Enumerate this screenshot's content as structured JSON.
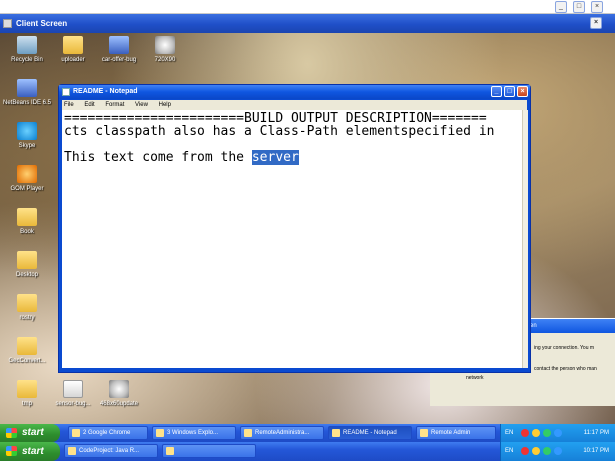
{
  "outer": {
    "title": "Client Screen"
  },
  "desktop_icons": [
    {
      "label": "Recycle Bin"
    },
    {
      "label": "uploader"
    },
    {
      "label": "car-offer-bug"
    },
    {
      "label": "720X90"
    },
    {
      "label": "NetBeans IDE 6.5"
    },
    {
      "label": "Skype"
    },
    {
      "label": "GOM Player"
    },
    {
      "label": "Book"
    },
    {
      "label": "Desktop"
    },
    {
      "label": "rostry"
    },
    {
      "label": "GecConvert..."
    },
    {
      "label": "tmp"
    },
    {
      "label": "sensor-bug..."
    },
    {
      "label": "468x60update"
    }
  ],
  "notepad": {
    "title": "README - Notepad",
    "menu": [
      "File",
      "Edit",
      "Format",
      "View",
      "Help"
    ],
    "lines": [
      "=======================BUILD OUTPUT DESCRIPTION=======",
      "cts classpath also has a Class-Path elementspecified in",
      ""
    ],
    "last_line_prefix": "This text come from the ",
    "selected_text": "server"
  },
  "side_dialog": {
    "bar_text": "en",
    "line1": "ing your connection. You m",
    "line2": "contact the person who man",
    "line3": "network"
  },
  "taskbar_inner": {
    "start_label": "start",
    "buttons": [
      {
        "label": "2 Google Chrome"
      },
      {
        "label": "3 Windows Explo..."
      },
      {
        "label": "RemoteAdministra..."
      },
      {
        "label": "README - Notepad"
      },
      {
        "label": "Remote Admin"
      }
    ],
    "lang": "EN",
    "clock": "11:17 PM"
  },
  "taskbar_outer": {
    "start_label": "start",
    "buttons": [
      {
        "label": "CodeProject: Java R..."
      },
      {
        "label": ""
      }
    ],
    "lang": "EN",
    "clock": "10:17 PM"
  }
}
